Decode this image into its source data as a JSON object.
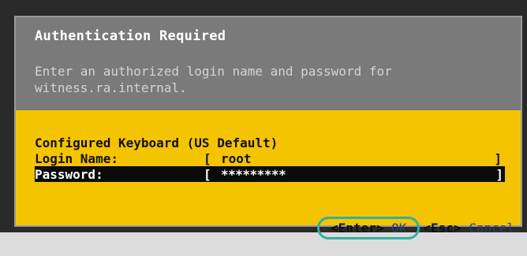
{
  "dialog": {
    "title": "Authentication Required",
    "message": "Enter an authorized login name and password for\nwitness.ra.internal."
  },
  "form": {
    "keyboard_label": "Configured Keyboard (US Default)",
    "login": {
      "label": "Login Name:",
      "open_bracket": "[",
      "value": "root",
      "close_bracket": "]"
    },
    "password": {
      "label": "Password:",
      "open_bracket": "[",
      "value": "*********",
      "close_bracket": "]"
    }
  },
  "actions": {
    "ok_key": "<Enter>",
    "ok_label": "OK",
    "cancel_key": "<Esc>",
    "cancel_label": "Cancel"
  },
  "colors": {
    "header_bg": "#7a7a7a",
    "body_bg": "#f5c400",
    "selected_row_bg": "#0b0b0b",
    "highlight_ring": "#2fb0a4"
  }
}
